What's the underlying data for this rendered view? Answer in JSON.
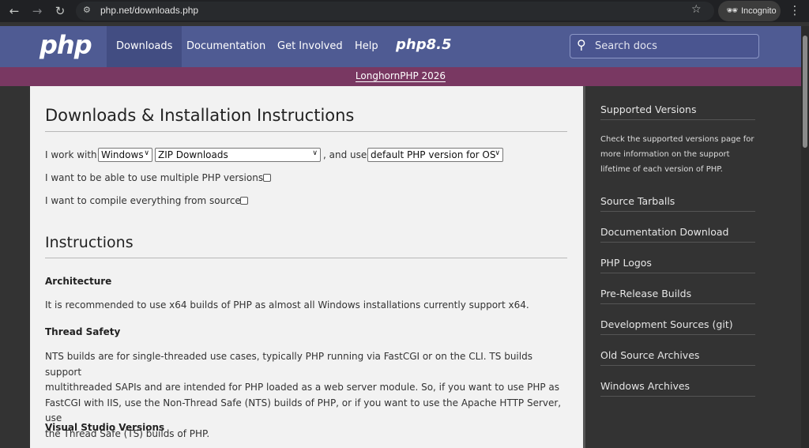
{
  "browser": {
    "url": "php.net/downloads.php",
    "incognito_label": "Incognito",
    "icons": {
      "back": "arrow-left-icon",
      "forward": "arrow-right-icon",
      "reload": "reload-icon",
      "site": "site-settings-icon",
      "bookmark": "star-icon",
      "incognito": "incognito-icon",
      "menu": "kebab-menu-icon"
    }
  },
  "header": {
    "logo": "php",
    "nav": [
      "Downloads",
      "Documentation",
      "Get Involved",
      "Help"
    ],
    "version_logo": "php8.5",
    "search_placeholder": "Search docs",
    "brand_color": "#4f5b93"
  },
  "banner": {
    "text": "LonghornPHP 2026",
    "color": "#793862"
  },
  "main": {
    "title": "Downloads & Installation Instructions",
    "form": {
      "prefix": "I work with",
      "os_value": "Windows",
      "method_value": "ZIP Downloads",
      "connector": ", and use",
      "version_value": "default PHP version for OS",
      "multiple_label": "I want to be able to use multiple PHP versions:",
      "multiple_checked": false,
      "compile_label": "I want to compile everything from source:",
      "compile_checked": false
    },
    "instructions_title": "Instructions",
    "sections": [
      {
        "heading": "Architecture",
        "text": "It is recommended to use x64 builds of PHP as almost all Windows installations currently support x64."
      },
      {
        "heading": "Thread Safety",
        "lines": [
          "NTS builds are for single-threaded use cases, typically PHP running via FastCGI or on the CLI. TS builds support",
          "multithreaded SAPIs and are intended for PHP loaded as a web server module. So, if you want to use PHP as",
          "FastCGI with IIS, use the Non-Thread Safe (NTS) builds of PHP, or if you want to use the Apache HTTP Server, use",
          "the Thread Safe (TS) builds of PHP."
        ]
      },
      {
        "heading": "Visual Studio Versions"
      }
    ]
  },
  "sidebar": {
    "first_link": "Supported Versions",
    "note_lines": [
      "Check the supported versions page for",
      "more information on the support",
      "lifetime of each version of PHP."
    ],
    "links": [
      "Source Tarballs",
      "Documentation Download",
      "PHP Logos",
      "Pre-Release Builds",
      "Development Sources (git)",
      "Old Source Archives",
      "Windows Archives"
    ]
  }
}
